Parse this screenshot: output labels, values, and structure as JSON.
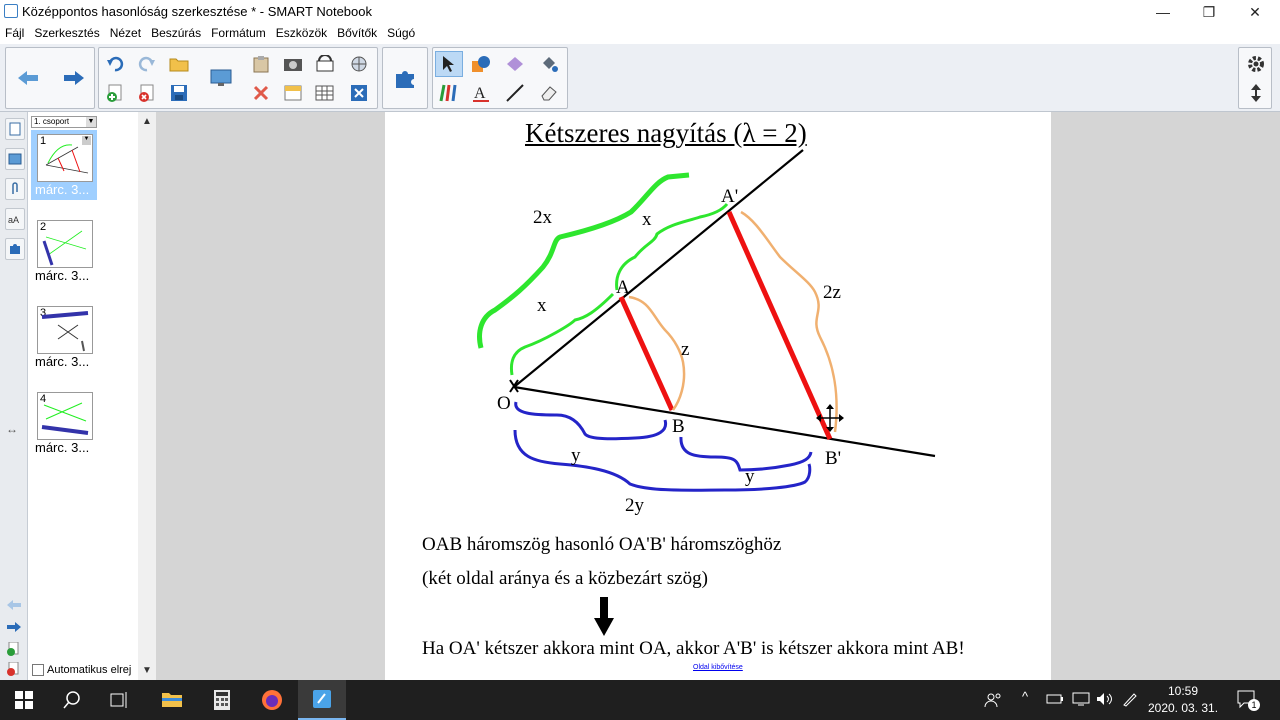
{
  "window": {
    "title": "Középpontos hasonlóság szerkesztése * - SMART Notebook",
    "minimize": "—",
    "maximize": "❐",
    "close": "✕"
  },
  "menu": [
    "Fájl",
    "Szerkesztés",
    "Nézet",
    "Beszúrás",
    "Formátum",
    "Eszközök",
    "Bővítők",
    "Súgó"
  ],
  "sorter": {
    "group": "1. csoport",
    "pages": [
      {
        "num": "1",
        "label": "márc. 3..."
      },
      {
        "num": "2",
        "label": "márc. 3..."
      },
      {
        "num": "3",
        "label": "márc. 3..."
      },
      {
        "num": "4",
        "label": "márc. 3..."
      }
    ],
    "auto_label": "Automatikus elrej"
  },
  "slide": {
    "title": "Kétszeres nagyítás (λ = 2)",
    "labels": {
      "O": "O",
      "A": "A",
      "A2": "A'",
      "B": "B",
      "B2": "B'",
      "x1": "x",
      "x2": "x",
      "two_x": "2x",
      "z": "z",
      "two_z": "2z",
      "y1": "y",
      "y2": "y",
      "two_y": "2y"
    },
    "line1": "OAB háromszög hasonló OA'B' háromszöghöz",
    "line2": "(két oldal aránya és a közbezárt szög)",
    "line3": "Ha OA' kétszer akkora mint OA, akkor A'B' is kétszer akkora mint AB!",
    "link": "Oldal kibővítése"
  },
  "taskbar": {
    "time": "10:59",
    "date": "2020. 03. 31.",
    "notifications": "1"
  },
  "colors": {
    "green": "#2ee62e",
    "red": "#ee1111",
    "orange": "#f0b070",
    "blue": "#2424c8",
    "selection": "#9fcfff"
  }
}
